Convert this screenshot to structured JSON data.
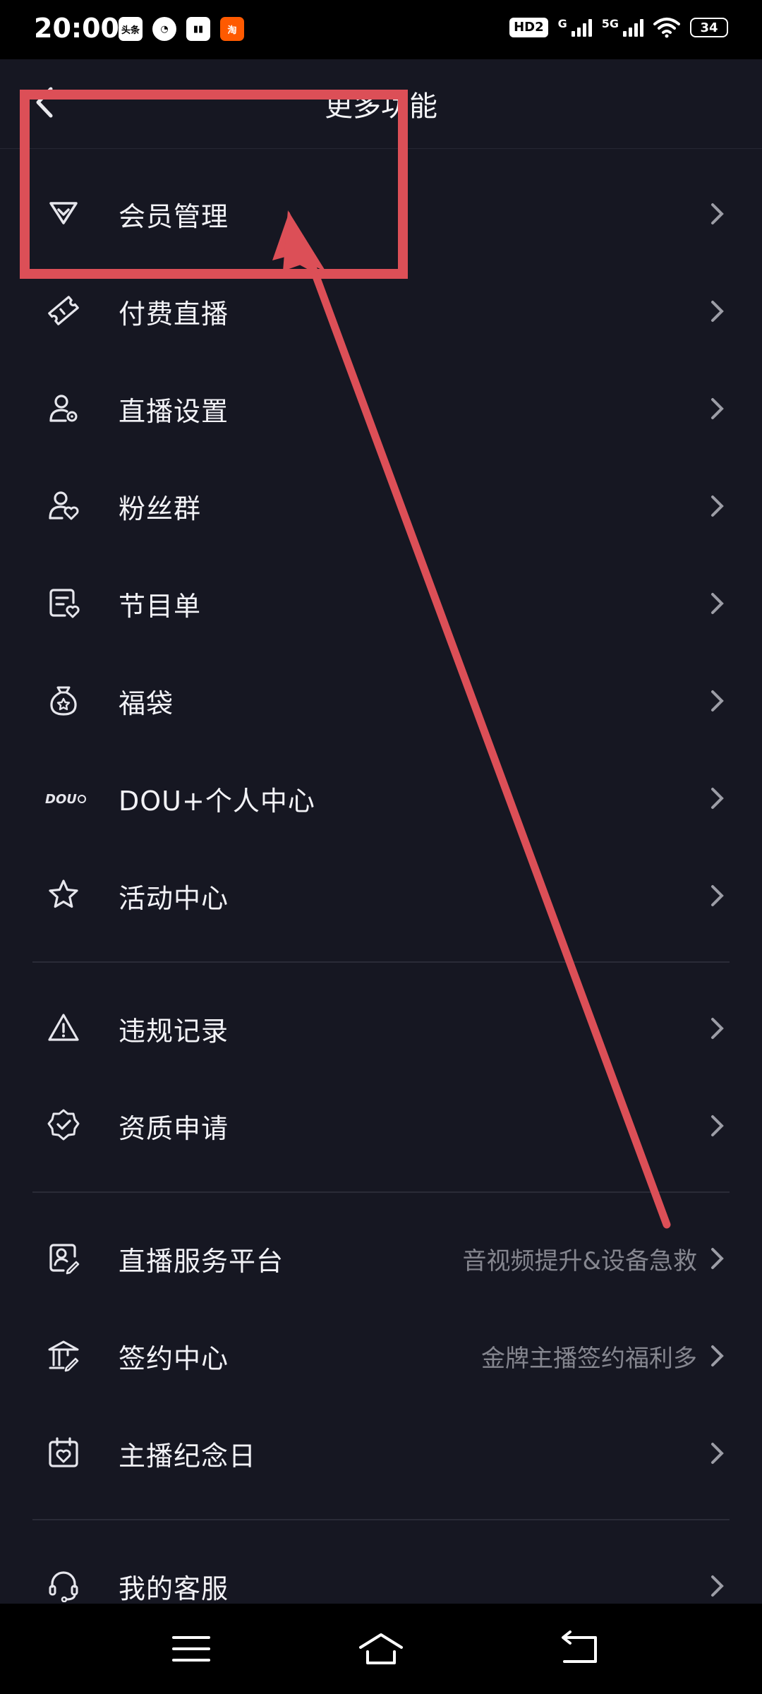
{
  "status_bar": {
    "time": "20:00",
    "notifications": [
      "头条",
      "◔",
      "▮▮",
      "淘"
    ],
    "hd_label": "HD2",
    "network_1": "G",
    "network_2": "5G",
    "battery": "34"
  },
  "header": {
    "title": "更多功能"
  },
  "menu": {
    "items": [
      {
        "label": "会员管理",
        "icon": "vip-v-icon",
        "subtitle": ""
      },
      {
        "label": "付费直播",
        "icon": "ticket-icon",
        "subtitle": ""
      },
      {
        "label": "直播设置",
        "icon": "user-gear-icon",
        "subtitle": ""
      },
      {
        "label": "粉丝群",
        "icon": "user-heart-icon",
        "subtitle": ""
      },
      {
        "label": "节目单",
        "icon": "program-list-icon",
        "subtitle": ""
      },
      {
        "label": "福袋",
        "icon": "lucky-bag-icon",
        "subtitle": ""
      },
      {
        "label": "DOU+个人中心",
        "icon": "dou-plus-icon",
        "subtitle": "",
        "icon_text": "DOU"
      },
      {
        "label": "活动中心",
        "icon": "star-icon",
        "subtitle": ""
      },
      {
        "label": "违规记录",
        "icon": "warning-icon",
        "subtitle": ""
      },
      {
        "label": "资质申请",
        "icon": "verified-badge-icon",
        "subtitle": ""
      },
      {
        "label": "直播服务平台",
        "icon": "service-platform-icon",
        "subtitle": "音视频提升&设备急救"
      },
      {
        "label": "签约中心",
        "icon": "sign-contract-icon",
        "subtitle": "金牌主播签约福利多"
      },
      {
        "label": "主播纪念日",
        "icon": "calendar-heart-icon",
        "subtitle": ""
      },
      {
        "label": "我的客服",
        "icon": "headset-icon",
        "subtitle": ""
      }
    ]
  },
  "annotation": {
    "color": "#dc4f57"
  },
  "colors": {
    "background": "#161722",
    "text": "#f2f2f6",
    "subtext": "#85868f",
    "divider": "#2a2b37"
  }
}
